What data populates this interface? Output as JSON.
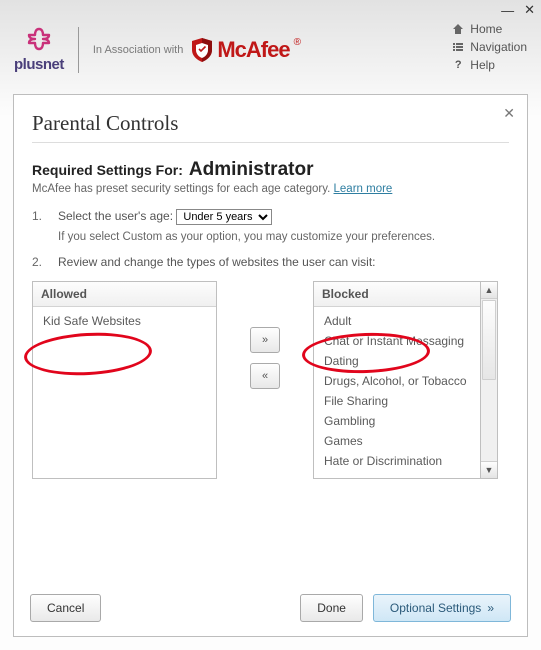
{
  "titlebar": {
    "minimize": "—",
    "close": "✕"
  },
  "brand": {
    "plusnet": "plusnet",
    "assoc": "In Association with",
    "mcafee": "McAfee",
    "trademark": "®"
  },
  "nav": {
    "home": "Home",
    "navigation": "Navigation",
    "help": "Help"
  },
  "panel": {
    "title": "Parental Controls",
    "required_label": "Required Settings For:",
    "required_value": "Administrator",
    "subtext": "McAfee has preset security settings for each age category.",
    "learn_more": "Learn more",
    "step1": {
      "num": "1.",
      "label": "Select the user's age:",
      "selected": "Under 5 years",
      "hint": "If you select Custom as your option, you may customize your preferences."
    },
    "step2": {
      "num": "2.",
      "label": "Review and change the types of websites the user can visit:"
    },
    "allowed_header": "Allowed",
    "blocked_header": "Blocked",
    "allowed_items": [
      "Kid Safe Websites"
    ],
    "blocked_items": [
      "Adult",
      "Chat or Instant Messaging",
      "Dating",
      "Drugs, Alcohol, or Tobacco",
      "File Sharing",
      "Gambling",
      "Games",
      "Hate or Discrimination"
    ],
    "mover_right": "»",
    "mover_left": "«"
  },
  "footer": {
    "cancel": "Cancel",
    "done": "Done",
    "optional": "Optional Settings",
    "chevron": "»"
  }
}
